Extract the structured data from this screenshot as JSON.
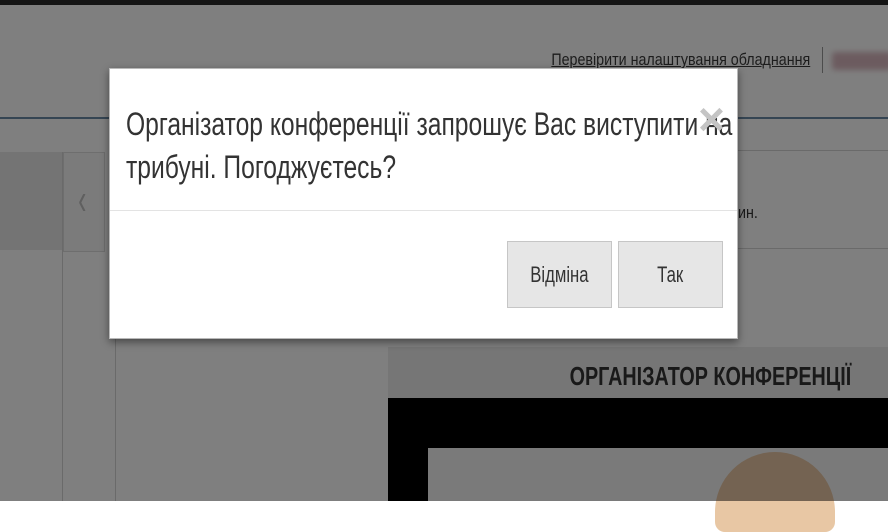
{
  "header": {
    "check_equipment_link": "Перевірити налаштування обладнання"
  },
  "background": {
    "right_text_fragment": "ин.",
    "organizer_title": "ОРГАНІЗАТОР КОНФЕРЕНЦІЇ",
    "nav_prev_icon": "chevron-left-icon"
  },
  "dialog": {
    "message_line1": "Організатор конференції запрошує Вас виступити на",
    "message_line2": "трибуні. Погоджуєтесь?",
    "close_icon": "close-icon",
    "close_glyph": "×",
    "cancel_label": "Відміна",
    "ok_label": "Так"
  },
  "colors": {
    "overlay": "rgba(0,0,0,0.5)",
    "header_line": "#6a8aa6",
    "button_bg": "#e6e6e6"
  }
}
